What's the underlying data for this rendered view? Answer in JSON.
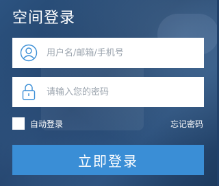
{
  "panel": {
    "title": "空间登录"
  },
  "username": {
    "placeholder": "用户名/邮箱/手机号",
    "icon": "user-icon"
  },
  "password": {
    "placeholder": "请输入您的密码",
    "icon": "lock-icon"
  },
  "remember": {
    "label": "自动登录",
    "checked": false
  },
  "forgot": {
    "label": "忘记密码"
  },
  "submit": {
    "label": "立即登录"
  },
  "colors": {
    "button": "#3a8ed6",
    "icon": "#3a8ed6",
    "text": "#ffffff"
  }
}
